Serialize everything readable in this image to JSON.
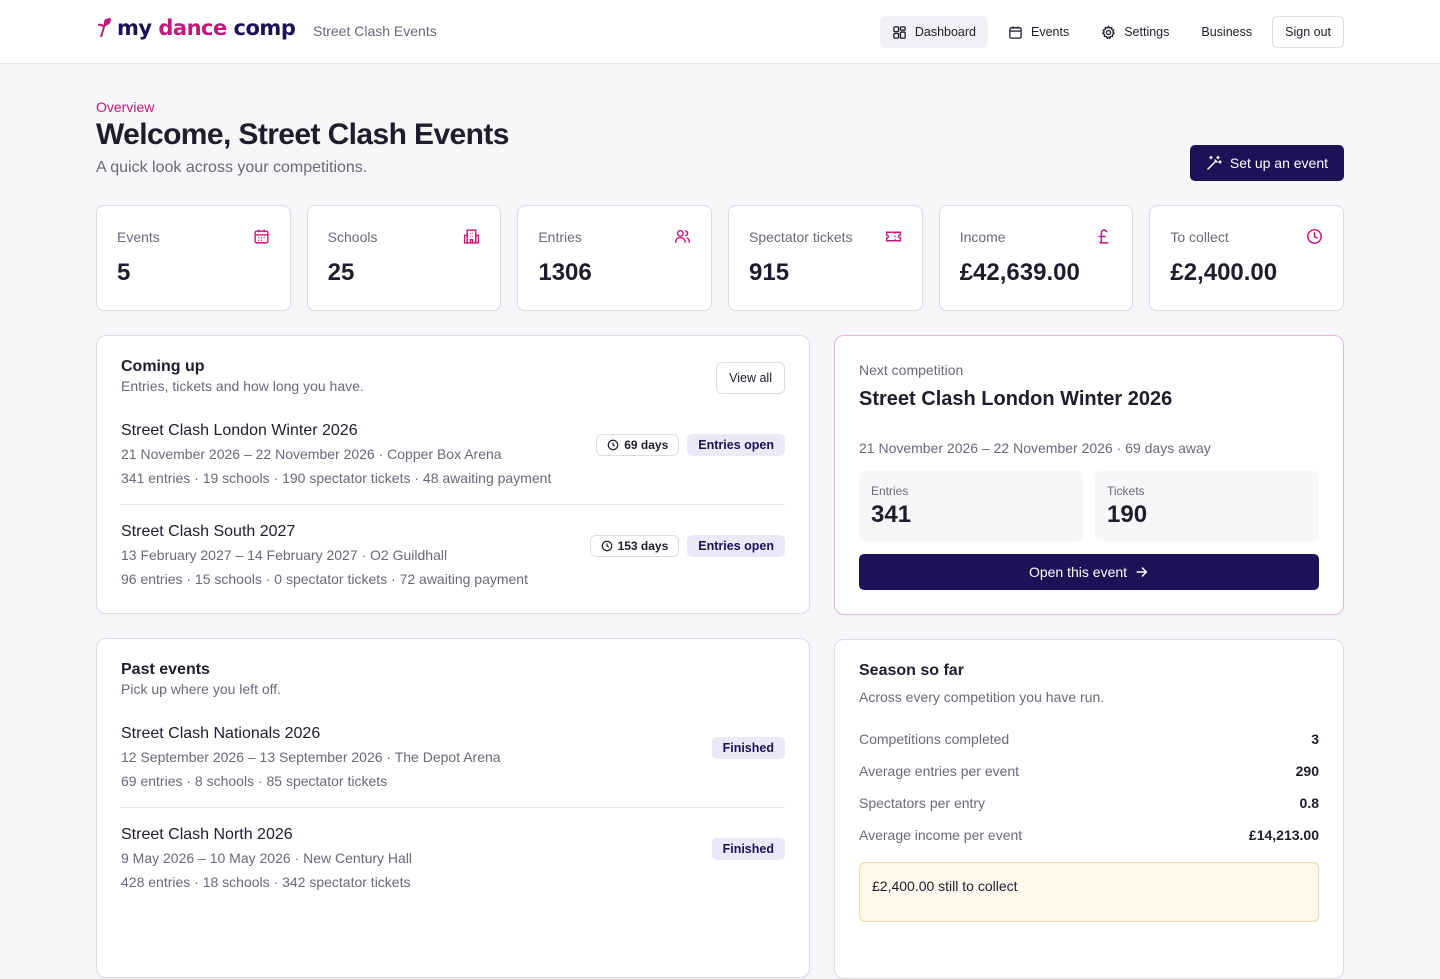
{
  "header": {
    "logo_prefix": "my ",
    "logo_accent": "dance",
    "logo_suffix": " comp",
    "org_name": "Street Clash Events",
    "nav": [
      {
        "label": "Dashboard",
        "icon": "dashboard-grid-icon",
        "active": true
      },
      {
        "label": "Events",
        "icon": "calendar-icon",
        "active": false
      },
      {
        "label": "Settings",
        "icon": "gear-icon",
        "active": false
      },
      {
        "label": "Business",
        "icon": "",
        "active": false
      }
    ],
    "sign_out": "Sign out"
  },
  "page": {
    "eyebrow": "Overview",
    "title": "Welcome, Street Clash Events",
    "subtitle": "A quick look across your competitions.",
    "setup_button": "Set up an event"
  },
  "stats": [
    {
      "label": "Events",
      "value": "5",
      "icon": "calendar-icon"
    },
    {
      "label": "Schools",
      "value": "25",
      "icon": "building-icon"
    },
    {
      "label": "Entries",
      "value": "1306",
      "icon": "users-icon"
    },
    {
      "label": "Spectator tickets",
      "value": "915",
      "icon": "ticket-icon"
    },
    {
      "label": "Income",
      "value": "£42,639.00",
      "icon": "pound-icon"
    },
    {
      "label": "To collect",
      "value": "£2,400.00",
      "icon": "clock-icon"
    }
  ],
  "coming_up": {
    "title": "Coming up",
    "subtitle": "Entries, tickets and how long you have.",
    "view_all": "View all",
    "events": [
      {
        "name": "Street Clash London Winter 2026",
        "meta": "21 November 2026 – 22 November 2026 · Copper Box Arena",
        "stats": "341 entries · 19 schools · 190 spectator tickets · 48 awaiting payment",
        "days": "69 days",
        "status": "Entries open"
      },
      {
        "name": "Street Clash South 2027",
        "meta": "13 February 2027 – 14 February 2027 · O2 Guildhall",
        "stats": "96 entries · 15 schools · 0 spectator tickets · 72 awaiting payment",
        "days": "153 days",
        "status": "Entries open"
      }
    ]
  },
  "past_events": {
    "title": "Past events",
    "subtitle": "Pick up where you left off.",
    "events": [
      {
        "name": "Street Clash Nationals 2026",
        "meta": "12 September 2026 – 13 September 2026 · The Depot Arena",
        "stats": "69 entries · 8 schools · 85 spectator tickets",
        "status": "Finished"
      },
      {
        "name": "Street Clash North 2026",
        "meta": "9 May 2026 – 10 May 2026 · New Century Hall",
        "stats": "428 entries · 18 schools · 342 spectator tickets",
        "status": "Finished"
      }
    ]
  },
  "next_competition": {
    "label": "Next competition",
    "name": "Street Clash London Winter 2026",
    "dates": "21 November 2026 – 22 November 2026 · 69 days away",
    "entries_label": "Entries",
    "entries_value": "341",
    "tickets_label": "Tickets",
    "tickets_value": "190",
    "open_button": "Open this event"
  },
  "season": {
    "title": "Season so far",
    "subtitle": "Across every competition you have run.",
    "rows": [
      {
        "label": "Competitions completed",
        "value": "3"
      },
      {
        "label": "Average entries per event",
        "value": "290"
      },
      {
        "label": "Spectators per entry",
        "value": "0.8"
      },
      {
        "label": "Average income per event",
        "value": "£14,213.00"
      }
    ],
    "collect_text": "£2,400.00 still to collect"
  },
  "colors": {
    "brand_navy": "#1c1255",
    "brand_pink": "#c2187a",
    "pill_bg": "#ece8f7"
  }
}
